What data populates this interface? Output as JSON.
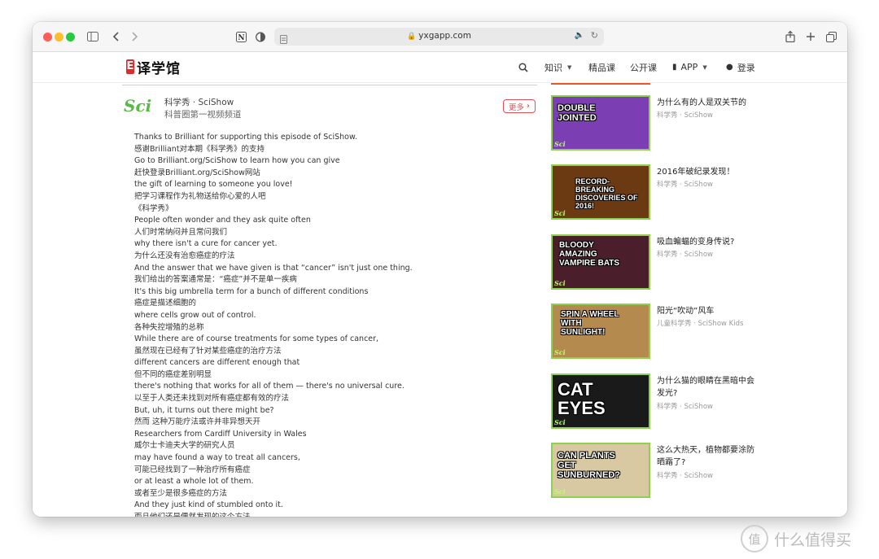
{
  "browser": {
    "url": "yxgapp.com"
  },
  "site": {
    "logo_text": "译学馆",
    "nav": [
      {
        "label": "知识",
        "has_caret": true
      },
      {
        "label": "精品课",
        "has_caret": false
      },
      {
        "label": "公开课",
        "has_caret": false
      },
      {
        "label": "APP",
        "has_caret": true
      },
      {
        "label": "登录",
        "has_caret": false
      }
    ]
  },
  "channel": {
    "logo": "Sci",
    "name": "科学秀 · SciShow",
    "description": "科普圈第一视频频道",
    "more_label": "更多"
  },
  "transcript": [
    "Thanks to Brilliant for supporting this episode of SciShow.",
    "感谢Brilliant对本期《科学秀》的支持",
    "Go to Brilliant.org/SciShow to learn how you can give",
    "赶快登录Brilliant.org/SciShow网站",
    "the gift of learning to someone you love!",
    "把学习课程作为礼物送给你心爱的人吧",
    "《科学秀》",
    "People often wonder and they ask quite often",
    "人们时常纳闷并且常问我们",
    "why there isn't a cure for cancer yet.",
    "为什么还没有治愈癌症的疗法",
    "And the answer that we have given is that “cancer” isn't just one thing.",
    "我们给出的答案通常是：“癌症”并不是单一疾病",
    "It's this big umbrella term for a bunch of different conditions",
    "癌症是描述细胞的",
    "where cells grow out of control.",
    "各种失控增殖的总称",
    "While there are of course treatments for some types of cancer,",
    "虽然现在已经有了针对某些癌症的治疗方法",
    "different cancers are different enough that",
    "但不同的癌症差别明显",
    "there's nothing that works for all of them — there's no universal cure.",
    "以至于人类还未找到对所有癌症都有效的疗法",
    "But, uh, it turns out there might be?",
    "然而 这种万能疗法或许并非异想天开",
    "Researchers from Cardiff University in Wales",
    "威尔士卡迪夫大学的研究人员",
    "may have found a way to treat all cancers,",
    "可能已经找到了一种治疗所有癌症",
    "or at least a whole lot of them.",
    "或者至少是很多癌症的方法",
    "And they just kind of stumbled onto it.",
    "而且他们还是偶然发现的这个方法"
  ],
  "videos": [
    {
      "thumb_text": "DOUBLE JOINTED",
      "title": "为什么有的人是双关节的",
      "meta": "科学秀 · SciShow",
      "bg": "#7b3fb3"
    },
    {
      "thumb_text": "RECORD-BREAKING DISCOVERIES OF 2016!",
      "title": "2016年破纪录发现！",
      "meta": "科学秀 · SciShow",
      "bg": "#6b3a12"
    },
    {
      "thumb_text": "BLOODY AMAZING VAMPIRE BATS",
      "title": "吸血蝙蝠的变身传说?",
      "meta": "科学秀 · SciShow",
      "bg": "#4a1f2b"
    },
    {
      "thumb_text": "SPIN A WHEEL WITH SUNLIGHT!",
      "title": "阳光“吹动”风车",
      "meta": "儿童科学秀 · SciShow Kids",
      "bg": "#b58a4f"
    },
    {
      "thumb_text": "CAT EYES",
      "title": "为什么猫的眼睛在黑暗中会发光?",
      "meta": "科学秀 · SciShow",
      "bg": "#1a1a1a"
    },
    {
      "thumb_text": "CAN PLANTS GET SUNBURNED?",
      "title": "这么大热天，植物都要涂防晒霜了?",
      "meta": "科学秀 · SciShow",
      "bg": "#d9c9a3"
    }
  ],
  "watermark": "什么值得买",
  "colors": {
    "accent": "#e0505a",
    "logo_red": "#e02b2b",
    "scishow_green": "#59b847"
  }
}
